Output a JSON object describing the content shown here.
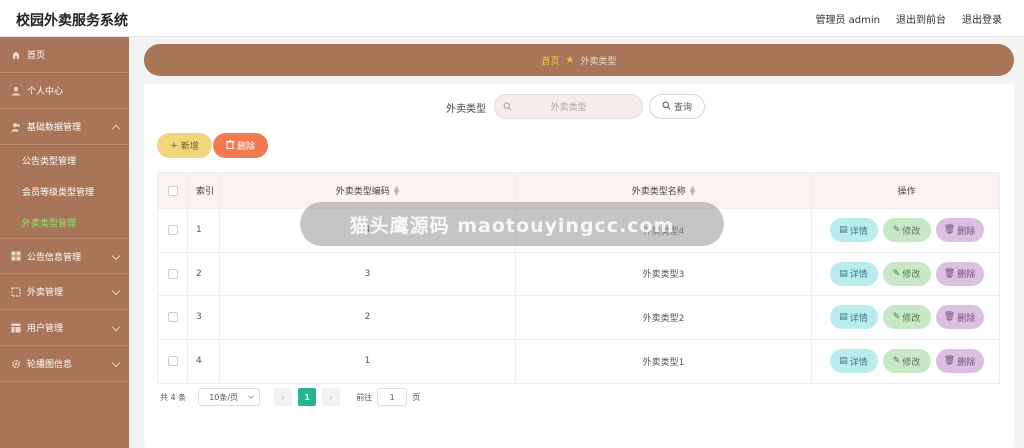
{
  "header": {
    "app_title": "校园外卖服务系统",
    "user_label": "管理员 admin",
    "back_to_front": "退出到前台",
    "logout": "退出登录"
  },
  "sidebar": {
    "items": [
      {
        "label": "首页",
        "icon": "home-icon"
      },
      {
        "label": "个人中心",
        "icon": "user-icon"
      },
      {
        "label": "基础数据管理",
        "icon": "users-icon",
        "expanded": true,
        "children": [
          {
            "label": "公告类型管理"
          },
          {
            "label": "会员等级类型管理"
          },
          {
            "label": "外卖类型管理",
            "active": true
          }
        ]
      },
      {
        "label": "公告信息管理",
        "icon": "grid-icon"
      },
      {
        "label": "外卖管理",
        "icon": "box-icon"
      },
      {
        "label": "用户管理",
        "icon": "table-icon"
      },
      {
        "label": "轮播图信息",
        "icon": "gear-icon"
      }
    ]
  },
  "breadcrumb": {
    "home": "首页",
    "current": "外卖类型"
  },
  "search": {
    "label": "外卖类型",
    "placeholder": "外卖类型",
    "query_button": "查询"
  },
  "toolbar": {
    "add_button": "新增",
    "delete_button": "删除"
  },
  "table": {
    "columns": [
      "索引",
      "外卖类型编码",
      "外卖类型名称",
      "操作"
    ],
    "rows": [
      {
        "index": "1",
        "code": "4",
        "name": "外卖类型4"
      },
      {
        "index": "2",
        "code": "3",
        "name": "外卖类型3"
      },
      {
        "index": "3",
        "code": "2",
        "name": "外卖类型2"
      },
      {
        "index": "4",
        "code": "1",
        "name": "外卖类型1"
      }
    ],
    "row_actions": {
      "detail": "详情",
      "edit": "修改",
      "delete": "删除"
    }
  },
  "pagination": {
    "total_text": "共 4 条",
    "page_size": "10条/页",
    "current_page": "1",
    "goto_label": "前往",
    "goto_value": "1",
    "page_unit": "页"
  },
  "watermark": {
    "text": "猫头鹰源码 maotouyingcc.com"
  },
  "colors": {
    "sidebar": "#a87558",
    "active_menu": "#8fe36a",
    "primary": "#24b58e",
    "add": "#f3d67c",
    "delete": "#f37a4f"
  }
}
